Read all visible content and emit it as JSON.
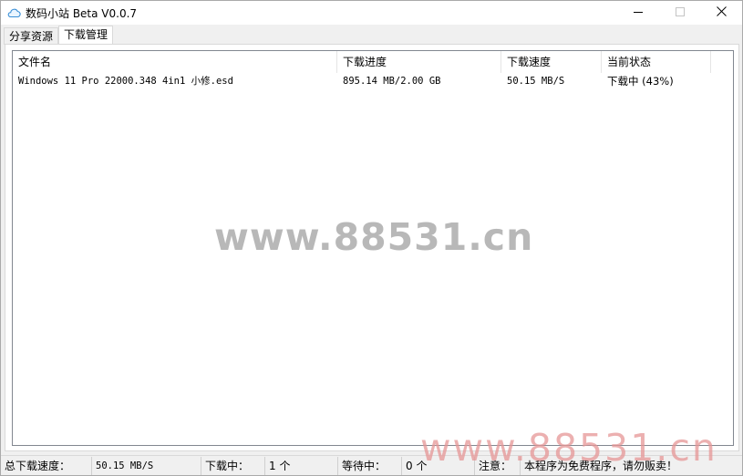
{
  "window": {
    "title": "数码小站 Beta V0.0.7"
  },
  "icons": {
    "app": "cloud-icon",
    "minimize": "minimize-icon",
    "maximize": "maximize-icon",
    "close": "close-icon"
  },
  "tabs": [
    {
      "label": "分享资源",
      "active": false
    },
    {
      "label": "下载管理",
      "active": true
    }
  ],
  "list": {
    "columns": [
      "文件名",
      "下载进度",
      "下载速度",
      "当前状态"
    ],
    "rows": [
      {
        "filename": "Windows 11 Pro 22000.348 4in1 小修.esd",
        "progress": "895.14 MB/2.00 GB",
        "speed": "50.15 MB/S",
        "status": "下载中 (43%)"
      }
    ]
  },
  "watermark": {
    "center": "www.88531.cn",
    "corner": "www.88531.cn"
  },
  "statusbar": {
    "total_speed_label": "总下载速度：",
    "total_speed_value": "50.15 MB/S",
    "downloading_label": "下载中：",
    "downloading_value": "1 个",
    "waiting_label": "等待中：",
    "waiting_value": "0 个",
    "notice_label": "注意：",
    "notice_text": "本程序为免费程序，请勿贩卖！"
  },
  "colors": {
    "window_bg": "#f0f0f0",
    "title_bg": "#ffffff",
    "list_border": "#828790",
    "watermark_gray": "#b8b8b8",
    "watermark_red": "#e69696"
  }
}
